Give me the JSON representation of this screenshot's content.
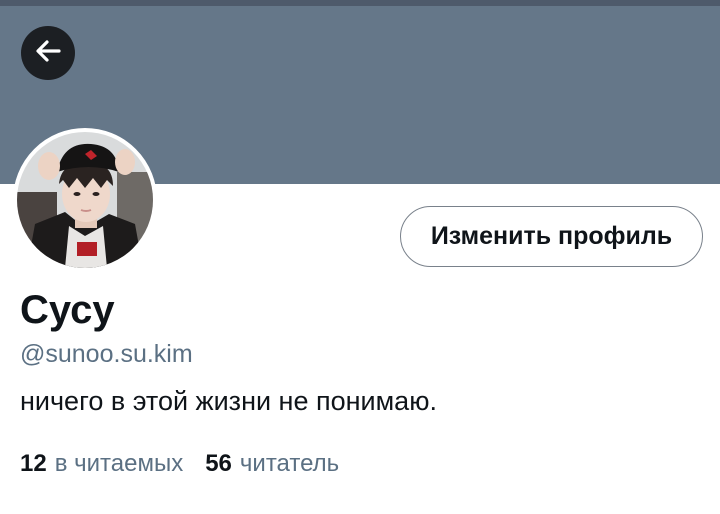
{
  "header": {
    "back_icon": "arrow-left-icon"
  },
  "profile": {
    "edit_button_label": "Изменить профиль",
    "name": "Сусу",
    "handle": "@sunoo.su.kim",
    "bio": "ничего в этой жизни не понимаю.",
    "stats": {
      "following_count": "12",
      "following_label": "в читаемых",
      "followers_count": "56",
      "followers_label": "читатель"
    }
  },
  "colors": {
    "banner": "#657789",
    "back_button": "#1c1f23",
    "text_primary": "#0f1419",
    "text_secondary": "#5b7083"
  }
}
